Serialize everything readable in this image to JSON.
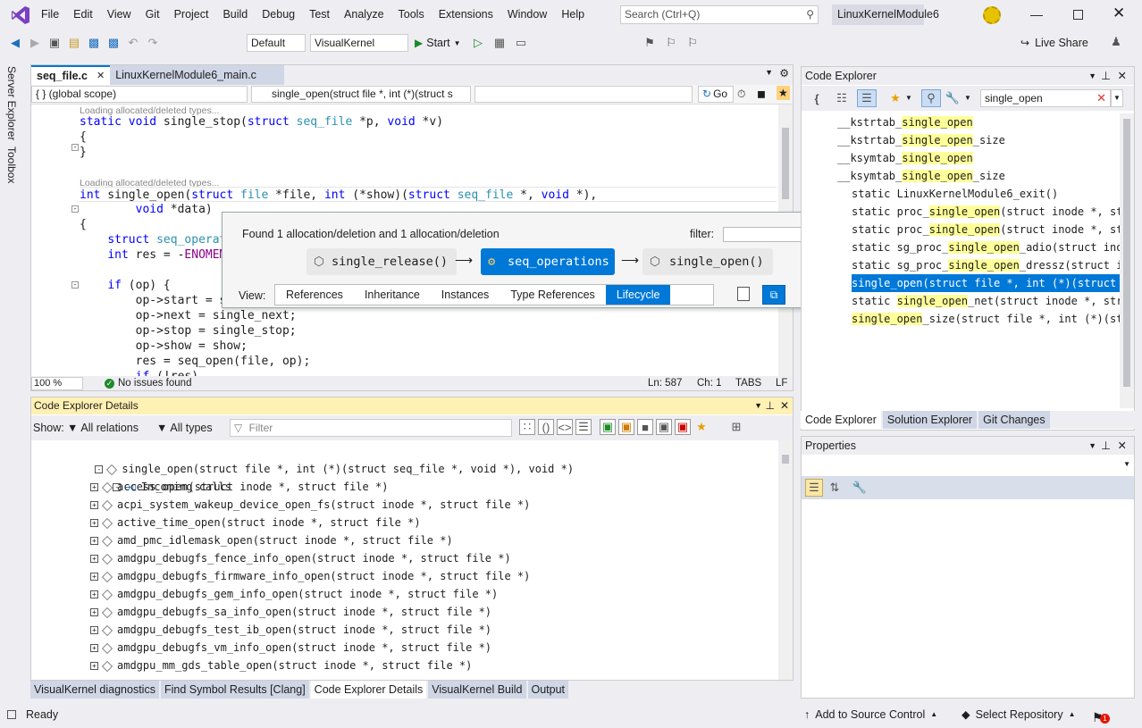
{
  "menu": [
    "File",
    "Edit",
    "View",
    "Git",
    "Project",
    "Build",
    "Debug",
    "Test",
    "Analyze",
    "Tools",
    "Extensions",
    "Window",
    "Help"
  ],
  "search_placeholder": "Search (Ctrl+Q)",
  "solution_name": "LinuxKernelModule6",
  "toolbar": {
    "config": "Default",
    "platform": "VisualKernel",
    "start_label": "Start",
    "live_share": "Live Share"
  },
  "left_strip": [
    "Server Explorer",
    "Toolbox"
  ],
  "editor": {
    "tabs": [
      "seq_file.c",
      "LinuxKernelModule6_main.c"
    ],
    "scope": "{ }  (global scope)",
    "function": "single_open(struct file *, int (*)(struct s",
    "go": "Go",
    "hint": "Loading allocated/deleted types...",
    "zoom": "100 %",
    "issues": "No issues found",
    "ln": "Ln: 587",
    "ch": "Ch: 1",
    "tabs_mode": "TABS",
    "eol": "LF"
  },
  "popup": {
    "found": "Found 1 allocation/deletion and 1 allocation/deletion",
    "filter_label": "filter:",
    "nodes": [
      "single_release()",
      "seq_operations",
      "single_open()"
    ],
    "view_label": "View:",
    "view_tabs": [
      "References",
      "Inheritance",
      "Instances",
      "Type References",
      "Lifecycle"
    ]
  },
  "details": {
    "title": "Code Explorer Details",
    "show_label": "Show:",
    "relations": "All relations",
    "types": "All types",
    "filter_placeholder": "Filter",
    "root": "single_open(struct file *, int (*)(struct seq_file *, void *), void *)",
    "incoming": "Incoming calls",
    "items": [
      "access_open(struct inode *, struct file *)",
      "acpi_system_wakeup_device_open_fs(struct inode *, struct file *)",
      "active_time_open(struct inode *, struct file *)",
      "amd_pmc_idlemask_open(struct inode *, struct file *)",
      "amdgpu_debugfs_fence_info_open(struct inode *, struct file *)",
      "amdgpu_debugfs_firmware_info_open(struct inode *, struct file *)",
      "amdgpu_debugfs_gem_info_open(struct inode *, struct file *)",
      "amdgpu_debugfs_sa_info_open(struct inode *, struct file *)",
      "amdgpu_debugfs_test_ib_open(struct inode *, struct file *)",
      "amdgpu_debugfs_vm_info_open(struct inode *, struct file *)",
      "amdgpu_mm_gds_table_open(struct inode *, struct file *)"
    ]
  },
  "bottom_tabs": [
    "VisualKernel diagnostics",
    "Find Symbol Results [Clang]",
    "Code Explorer Details",
    "VisualKernel Build",
    "Output"
  ],
  "code_explorer": {
    "title": "Code Explorer",
    "search_value": "single_open",
    "results": [
      {
        "pre": "__kstrtab_",
        "hl": "single_open",
        "post": ""
      },
      {
        "pre": "__kstrtab_",
        "hl": "single_open",
        "post": "_size"
      },
      {
        "pre": "__ksymtab_",
        "hl": "single_open",
        "post": ""
      },
      {
        "pre": "__ksymtab_",
        "hl": "single_open",
        "post": "_size"
      },
      {
        "pre": "static LinuxKernelModule6_exit()",
        "hl": "",
        "post": ""
      },
      {
        "pre": "static proc_",
        "hl": "single_open",
        "post": "(struct inode *, struc"
      },
      {
        "pre": "static proc_",
        "hl": "single_open",
        "post": "(struct inode *, struc"
      },
      {
        "pre": "static sg_proc_",
        "hl": "single_open",
        "post": "_adio(struct inode"
      },
      {
        "pre": "static sg_proc_",
        "hl": "single_open",
        "post": "_dressz(struct inod"
      },
      {
        "pre": "single_open(struct file *, int (*)(struct seq",
        "hl": "",
        "post": ""
      },
      {
        "pre": "static ",
        "hl": "single_open",
        "post": "_net(struct inode *, struct"
      },
      {
        "pre": "",
        "hl": "single_open",
        "post": "_size(struct file *, int (*)(struc"
      }
    ]
  },
  "right_tabs": [
    "Code Explorer",
    "Solution Explorer",
    "Git Changes"
  ],
  "properties_title": "Properties",
  "status": {
    "ready": "Ready",
    "source_control": "Add to Source Control",
    "repo": "Select Repository",
    "notif": "1"
  }
}
